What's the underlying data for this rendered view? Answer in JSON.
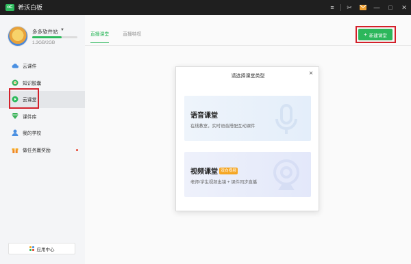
{
  "window": {
    "logo_text": "oC",
    "title": "希沃白板",
    "controls": [
      "≡",
      "✂",
      "✉",
      "—",
      "□",
      "✕"
    ]
  },
  "sidebar": {
    "user": {
      "name": "多多软件站",
      "storage": "1.3GB/2GB",
      "storage_fraction": 0.65
    },
    "items": [
      {
        "label": "云课件",
        "icon": "cloud-icon",
        "active": false
      },
      {
        "label": "知识胶囊",
        "icon": "capsule-icon",
        "active": false
      },
      {
        "label": "云课堂",
        "icon": "play-circle-icon",
        "active": true
      },
      {
        "label": "课件库",
        "icon": "diamond-icon",
        "active": false
      },
      {
        "label": "我的学校",
        "icon": "school-icon",
        "active": false
      },
      {
        "label": "做任务赢奖励",
        "icon": "gift-icon",
        "active": false,
        "dot": true
      }
    ],
    "app_center": "应用中心"
  },
  "main": {
    "tabs": [
      {
        "label": "直播课堂",
        "active": true
      },
      {
        "label": "直播特权",
        "active": false
      }
    ],
    "new_class_button": "新建课堂"
  },
  "dialog": {
    "title": "请选择课堂类型",
    "close": "×",
    "options": [
      {
        "title": "语音课堂",
        "subtitle": "在线教室，实时语音搭配互动课件",
        "badge": ""
      },
      {
        "title": "视频课堂",
        "subtitle": "老师/学生视频出镜 + 课件同步直播",
        "badge": "双向视频"
      }
    ]
  },
  "colors": {
    "accent": "#2dbb5d",
    "titlebar": "#1f1f1f",
    "highlight": "#d3202a",
    "badge": "#f5a623"
  }
}
